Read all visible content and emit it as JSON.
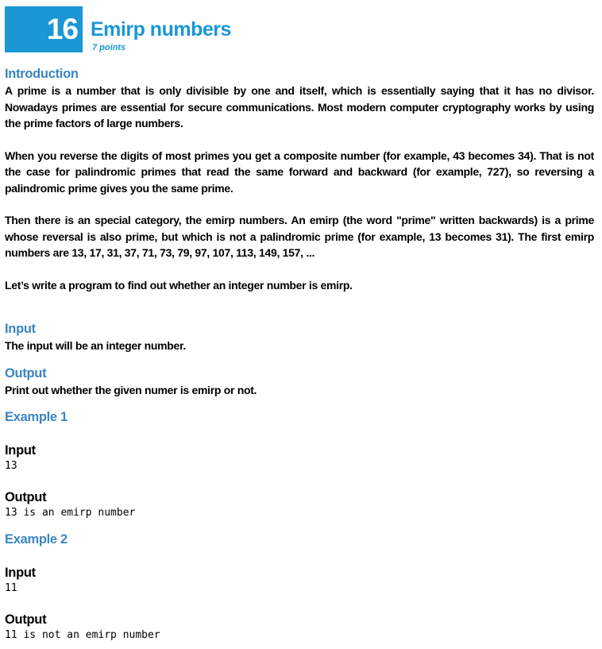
{
  "problem": {
    "number": "16",
    "title": "Emirp numbers",
    "points": "7 points"
  },
  "introduction": {
    "heading": "Introduction",
    "paragraphs": [
      "A prime is a number that is only divisible by one and itself, which is essentially saying that it has no divisor. Nowadays primes are essential for secure communications. Most modern computer cryptography works by using the prime factors of large numbers.",
      "When you reverse the digits of most primes you get a composite number (for example, 43 becomes 34). That is not the case for palindromic primes that read the same forward and backward (for example, 727), so reversing a palindromic prime gives you the same prime.",
      "Then there is an special category, the emirp numbers. An emirp (the word \"prime\" written backwards) is a prime whose reversal is also prime, but which is not a palindromic prime (for example, 13 becomes 31). The first emirp numbers are 13, 17, 31, 37, 71, 73, 79, 97, 107, 113, 149, 157, ...",
      "Let’s write a program to find out whether an integer number is emirp."
    ]
  },
  "input": {
    "heading": "Input",
    "text": "The input will be an integer number."
  },
  "output": {
    "heading": "Output",
    "text": "Print out whether the given numer is emirp or not."
  },
  "examples": [
    {
      "heading": "Example 1",
      "input_label": "Input",
      "input_value": "13",
      "output_label": "Output",
      "output_value": "13 is an emirp number"
    },
    {
      "heading": "Example 2",
      "input_label": "Input",
      "input_value": "11",
      "output_label": "Output",
      "output_value": "11 is not an emirp number"
    }
  ],
  "colors": {
    "badge": "#1a97d4",
    "heading": "#3a86c1"
  }
}
